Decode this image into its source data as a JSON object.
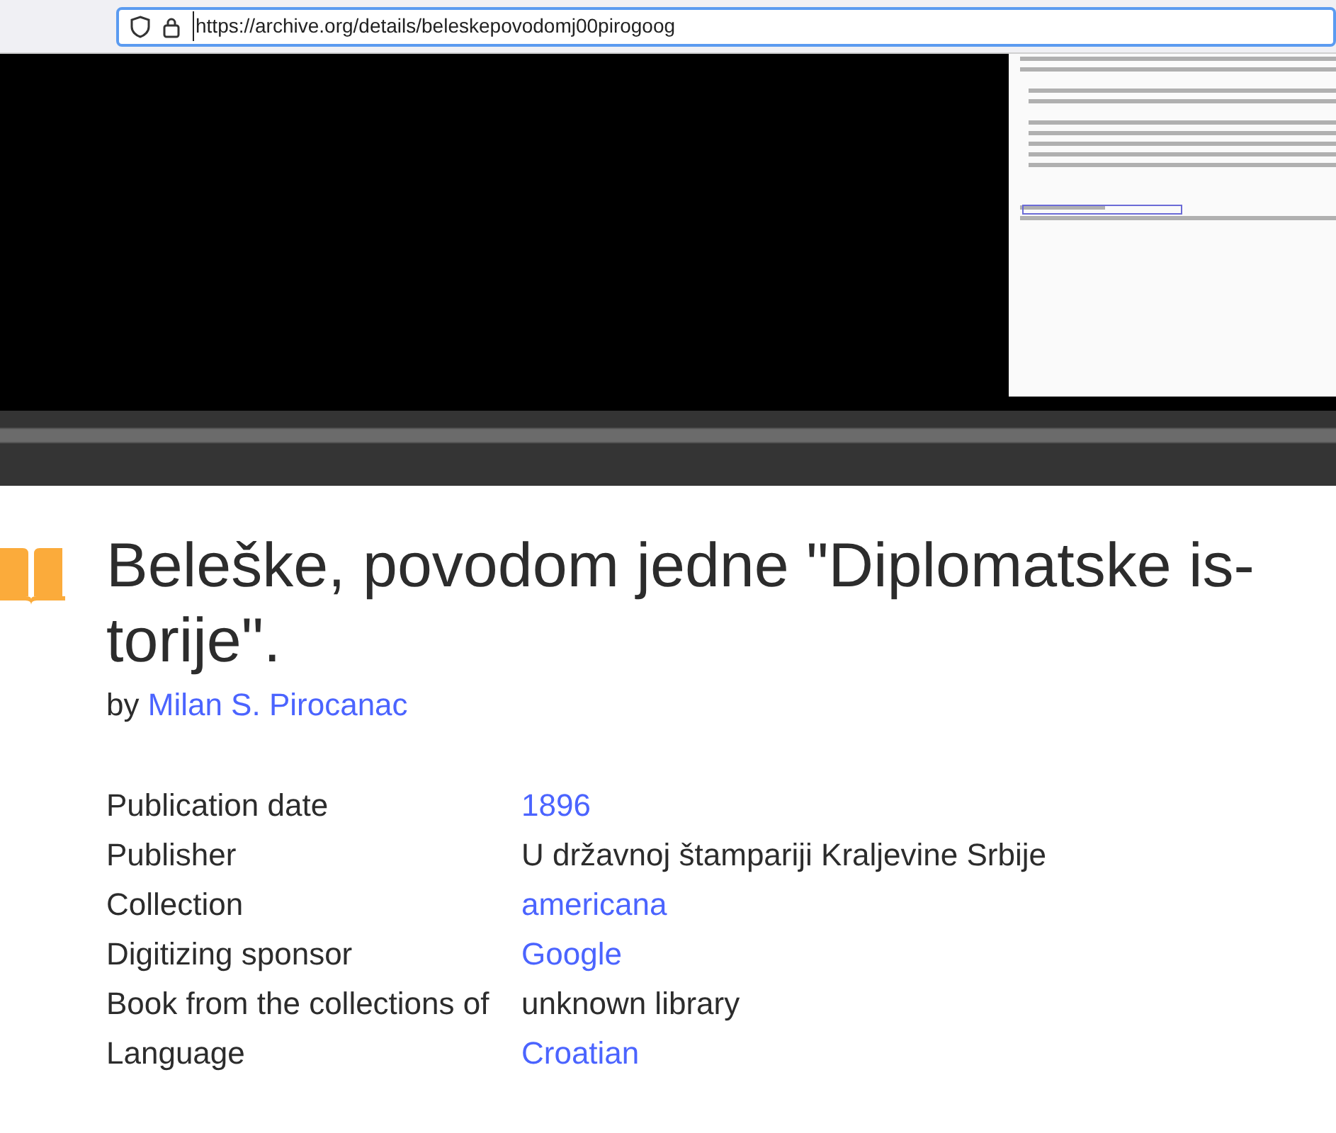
{
  "address_bar": {
    "url": "https://archive.org/details/beleskepovodomj00pirogoog"
  },
  "item": {
    "title": "Beleške, povodom jedne \"Diplomatske is-torije\".",
    "by_label": "by",
    "author": "Milan S. Pirocanac"
  },
  "metadata": [
    {
      "label": "Publication date",
      "value": "1896",
      "kind": "link"
    },
    {
      "label": "Publisher",
      "value": "U državnoj štampariji Kraljevine Srbije",
      "kind": "text"
    },
    {
      "label": "Collection",
      "value": "americana",
      "kind": "link"
    },
    {
      "label": "Digitizing sponsor",
      "value": "Google",
      "kind": "link"
    },
    {
      "label": "Book from the collections of",
      "value": "unknown library",
      "kind": "text"
    },
    {
      "label": "Language",
      "value": "Croatian",
      "kind": "link"
    }
  ]
}
